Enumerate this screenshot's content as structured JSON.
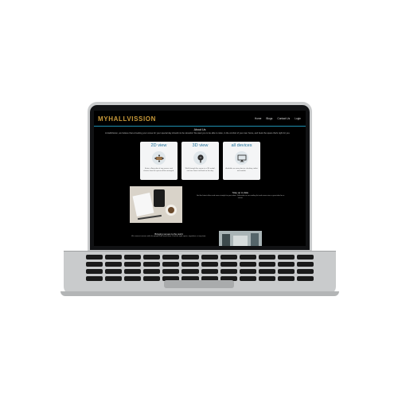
{
  "site": {
    "logo": "MYHALLVISSION"
  },
  "nav": {
    "links": [
      "Home",
      "Blogs",
      "Contact Us",
      "Login"
    ]
  },
  "about": {
    "title": "About Us",
    "text": "At HallVission, we believe that a booking your venue for your special day should not be stressful. We want you to be able to relax, in the comfort of your own home, and book the space that's right for you."
  },
  "cards": [
    {
      "title": "2D view",
      "icon": "table-icon",
      "text": "Enter a floor plan of any venue, and choose how the space will be arranged."
    },
    {
      "title": "3D view",
      "icon": "camera-360-icon",
      "text": "Walk through the venue in a 3D model, and see how it will look on the day."
    },
    {
      "title": "all devices",
      "icon": "monitor-icon",
      "text": "Available on every device: desktop, tablet and mobile."
    }
  ],
  "subscribe": {
    "title": "Stay up to date",
    "text": "Get the latest offers and news straight to your inbox. Subscribe to our mailing list and never miss a great deal on a venue."
  },
  "world": {
    "title": "Bringing venues to the world",
    "text": "We connect venues with the people who need them. Find the right space, anywhere, at any time."
  }
}
